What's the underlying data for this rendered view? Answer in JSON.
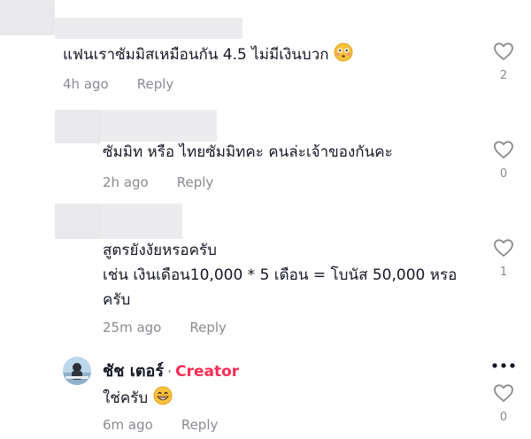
{
  "comments": [
    {
      "text_lines": [
        "แฟนเราซัมมิสเหมือนกัน 4.5 ไม่มีเงินบวก"
      ],
      "emoji": "flushed-face",
      "time": "4h ago",
      "reply_label": "Reply",
      "likes": "2"
    },
    {
      "text_lines": [
        "ซัมมิท หรือ ไทยซัมมิทคะ คนล่ะเจ้าของกันคะ"
      ],
      "time": "2h ago",
      "reply_label": "Reply",
      "likes": "0"
    },
    {
      "text_lines": [
        "สูตรยังงัยหรอครับ",
        "เช่น เงินเดือน10,000 * 5 เดือน = โบนัส 50,000 หรอ",
        "ครับ"
      ],
      "time": "25m ago",
      "reply_label": "Reply",
      "likes": "1"
    },
    {
      "author": "ชัช เตอร์",
      "separator": "·",
      "badge": "Creator",
      "text_lines": [
        "ใช่ครับ"
      ],
      "emoji": "grinning-face",
      "time": "6m ago",
      "reply_label": "Reply",
      "likes": "0"
    }
  ],
  "colors": {
    "creator": "#fe2c55",
    "meta": "#8a8b91",
    "text": "#161823"
  }
}
